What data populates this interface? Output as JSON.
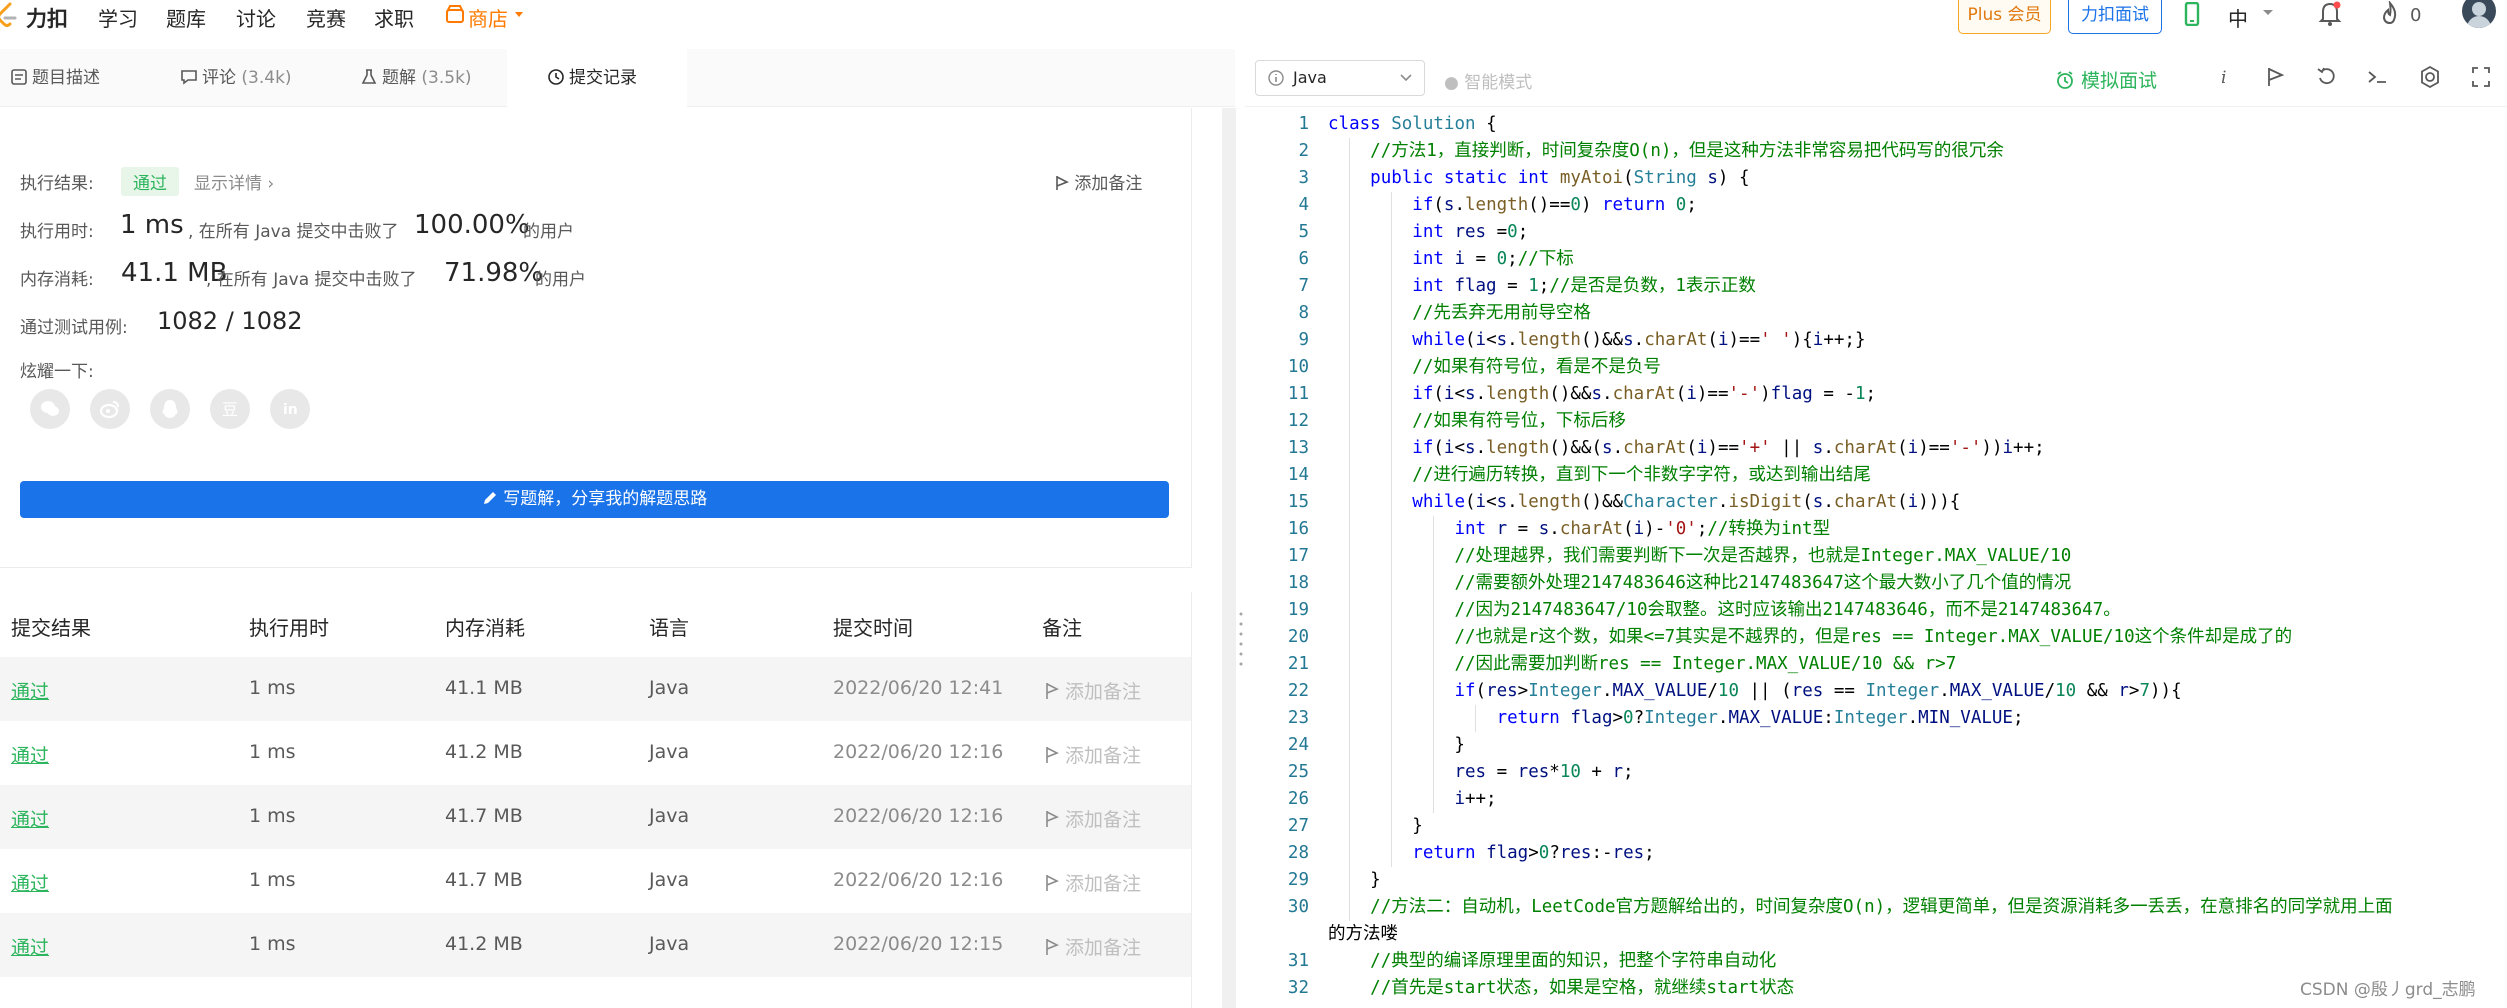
{
  "brand": "力扣",
  "nav": {
    "items": [
      "学习",
      "题库",
      "讨论",
      "竞赛",
      "求职",
      "商店"
    ]
  },
  "top_buttons": {
    "plus": "Plus 会员",
    "interview": "力扣面试",
    "lang": "中",
    "notif_count": "0"
  },
  "tabs": [
    {
      "label": "题目描述",
      "count": ""
    },
    {
      "label": "评论",
      "count": "(3.4k)"
    },
    {
      "label": "题解",
      "count": "(3.5k)"
    },
    {
      "label": "提交记录",
      "count": ""
    }
  ],
  "result": {
    "status_label": "执行结果:",
    "status": "通过",
    "details_link": "显示详情",
    "add_note": "添加备注",
    "time_label": "执行用时:",
    "time": "1 ms",
    "time_mid": ", 在所有 Java 提交中击败了",
    "time_pct": "100.00%",
    "time_tail": "的用户",
    "mem_label": "内存消耗:",
    "mem": "41.1 MB",
    "mem_mid": ", 在所有 Java 提交中击败了",
    "mem_pct": "71.98%",
    "mem_tail": "的用户",
    "tests_label": "通过测试用例:",
    "tests": "1082 / 1082",
    "share_label": "炫耀一下:",
    "share_icons": [
      "wechat-icon",
      "weibo-icon",
      "qq-icon",
      "douban-icon",
      "linkedin-icon"
    ],
    "write_button": "写题解，分享我的解题思路"
  },
  "table": {
    "headers": [
      "提交结果",
      "执行用时",
      "内存消耗",
      "语言",
      "提交时间",
      "备注"
    ],
    "rows": [
      {
        "status": "通过",
        "time": "1 ms",
        "memory": "41.1 MB",
        "lang": "Java",
        "date": "2022/06/20 12:41",
        "note": "添加备注"
      },
      {
        "status": "通过",
        "time": "1 ms",
        "memory": "41.2 MB",
        "lang": "Java",
        "date": "2022/06/20 12:16",
        "note": "添加备注"
      },
      {
        "status": "通过",
        "time": "1 ms",
        "memory": "41.7 MB",
        "lang": "Java",
        "date": "2022/06/20 12:16",
        "note": "添加备注"
      },
      {
        "status": "通过",
        "time": "1 ms",
        "memory": "41.7 MB",
        "lang": "Java",
        "date": "2022/06/20 12:16",
        "note": "添加备注"
      },
      {
        "status": "通过",
        "time": "1 ms",
        "memory": "41.2 MB",
        "lang": "Java",
        "date": "2022/06/20 12:15",
        "note": "添加备注"
      }
    ]
  },
  "editor": {
    "language": "Java",
    "smart_mode": "智能模式",
    "mock_interview": "模拟面试",
    "line_numbers": [
      "1",
      "2",
      "3",
      "4",
      "5",
      "6",
      "7",
      "8",
      "9",
      "10",
      "11",
      "12",
      "13",
      "14",
      "15",
      "16",
      "17",
      "18",
      "19",
      "20",
      "21",
      "22",
      "23",
      "24",
      "25",
      "26",
      "27",
      "28",
      "29",
      "30",
      "",
      "31",
      "32"
    ],
    "lines": [
      "class Solution {",
      "    //方法1，直接判断，时间复杂度O(n)，但是这种方法非常容易把代码写的很冗余",
      "    public static int myAtoi(String s) {",
      "        if(s.length()==0) return 0;",
      "        int res =0;",
      "        int i = 0;//下标",
      "        int flag = 1;//是否是负数，1表示正数",
      "        //先丢弃无用前导空格",
      "        while(i<s.length()&&s.charAt(i)==' '){i++;}",
      "        //如果有符号位，看是不是负号",
      "        if(i<s.length()&&s.charAt(i)=='-')flag = -1;",
      "        //如果有符号位，下标后移",
      "        if(i<s.length()&&(s.charAt(i)=='+' || s.charAt(i)=='-'))i++;",
      "        //进行遍历转换，直到下一个非数字字符，或达到输出结尾",
      "        while(i<s.length()&&Character.isDigit(s.charAt(i))){",
      "            int r = s.charAt(i)-'0';//转换为int型",
      "            //处理越界，我们需要判断下一次是否越界，也就是Integer.MAX_VALUE/10",
      "            //需要额外处理2147483646这种比2147483647这个最大数小了几个值的情况",
      "            //因为2147483647/10会取整。这时应该输出2147483646，而不是2147483647。",
      "            //也就是r这个数，如果<=7其实是不越界的，但是res == Integer.MAX_VALUE/10这个条件却是成了的",
      "            //因此需要加判断res == Integer.MAX_VALUE/10 && r>7",
      "            if(res>Integer.MAX_VALUE/10 || (res == Integer.MAX_VALUE/10 && r>7)){",
      "                return flag>0?Integer.MAX_VALUE:Integer.MIN_VALUE;",
      "            }",
      "            res = res*10 + r;",
      "            i++;",
      "        }",
      "        return flag>0?res:-res;",
      "    }",
      "    //方法二：自动机，LeetCode官方题解给出的，时间复杂度O(n)，逻辑更简单，但是资源消耗多一丢丢，在意排名的同学就用上面",
      "的方法喽",
      "    //典型的编译原理里面的知识，把整个字符串自动化",
      "    //首先是start状态，如果是空格，就继续start状态"
    ]
  },
  "watermark": "CSDN @殷丿grd_志鹏"
}
